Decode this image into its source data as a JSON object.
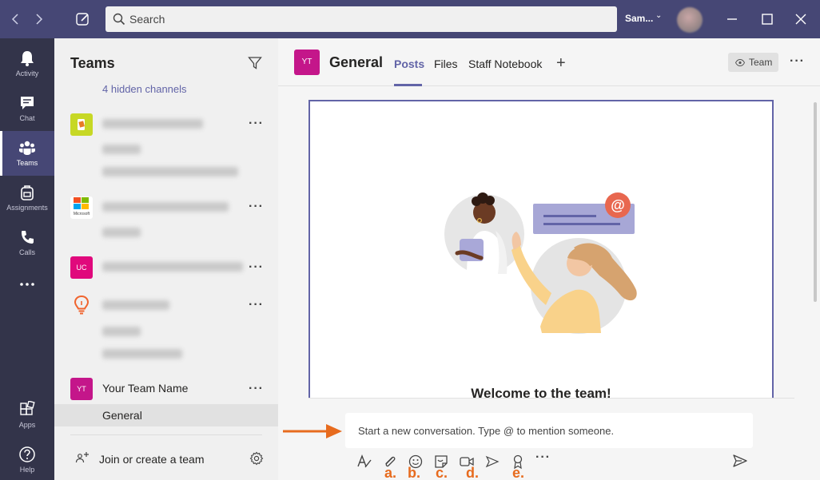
{
  "titlebar": {
    "search_placeholder": "Search",
    "user_name": "Sam..."
  },
  "rail": {
    "items": [
      {
        "label": "Activity",
        "icon": "bell-icon"
      },
      {
        "label": "Chat",
        "icon": "chat-icon"
      },
      {
        "label": "Teams",
        "icon": "teams-icon",
        "active": true
      },
      {
        "label": "Assignments",
        "icon": "backpack-icon"
      },
      {
        "label": "Calls",
        "icon": "phone-icon"
      },
      {
        "label": "",
        "icon": "more-icon"
      },
      {
        "label": "Apps",
        "icon": "apps-icon"
      },
      {
        "label": "Help",
        "icon": "help-icon"
      }
    ]
  },
  "panel": {
    "title": "Teams",
    "hidden_channels": "4 hidden channels",
    "team_icons": {
      "microsoft_label": "Microsoft",
      "uc": "UC",
      "yt": "YT"
    },
    "your_team": {
      "name": "Your Team Name",
      "channel": "General"
    },
    "join_label": "Join or create a team"
  },
  "main": {
    "channel_badge": "YT",
    "channel_title": "General",
    "tabs": [
      "Posts",
      "Files",
      "Staff Notebook"
    ],
    "team_button": "Team",
    "welcome": "Welcome to the team!",
    "compose_placeholder": "Start a new conversation. Type @ to mention someone.",
    "tool_labels": [
      "a.",
      "b.",
      "c.",
      "d.",
      "e."
    ]
  },
  "colors": {
    "titlebar": "#464775",
    "rail": "#33344a",
    "accent": "#6264a7",
    "annotation": "#e76b1e",
    "team_magenta": "#c4168a"
  }
}
